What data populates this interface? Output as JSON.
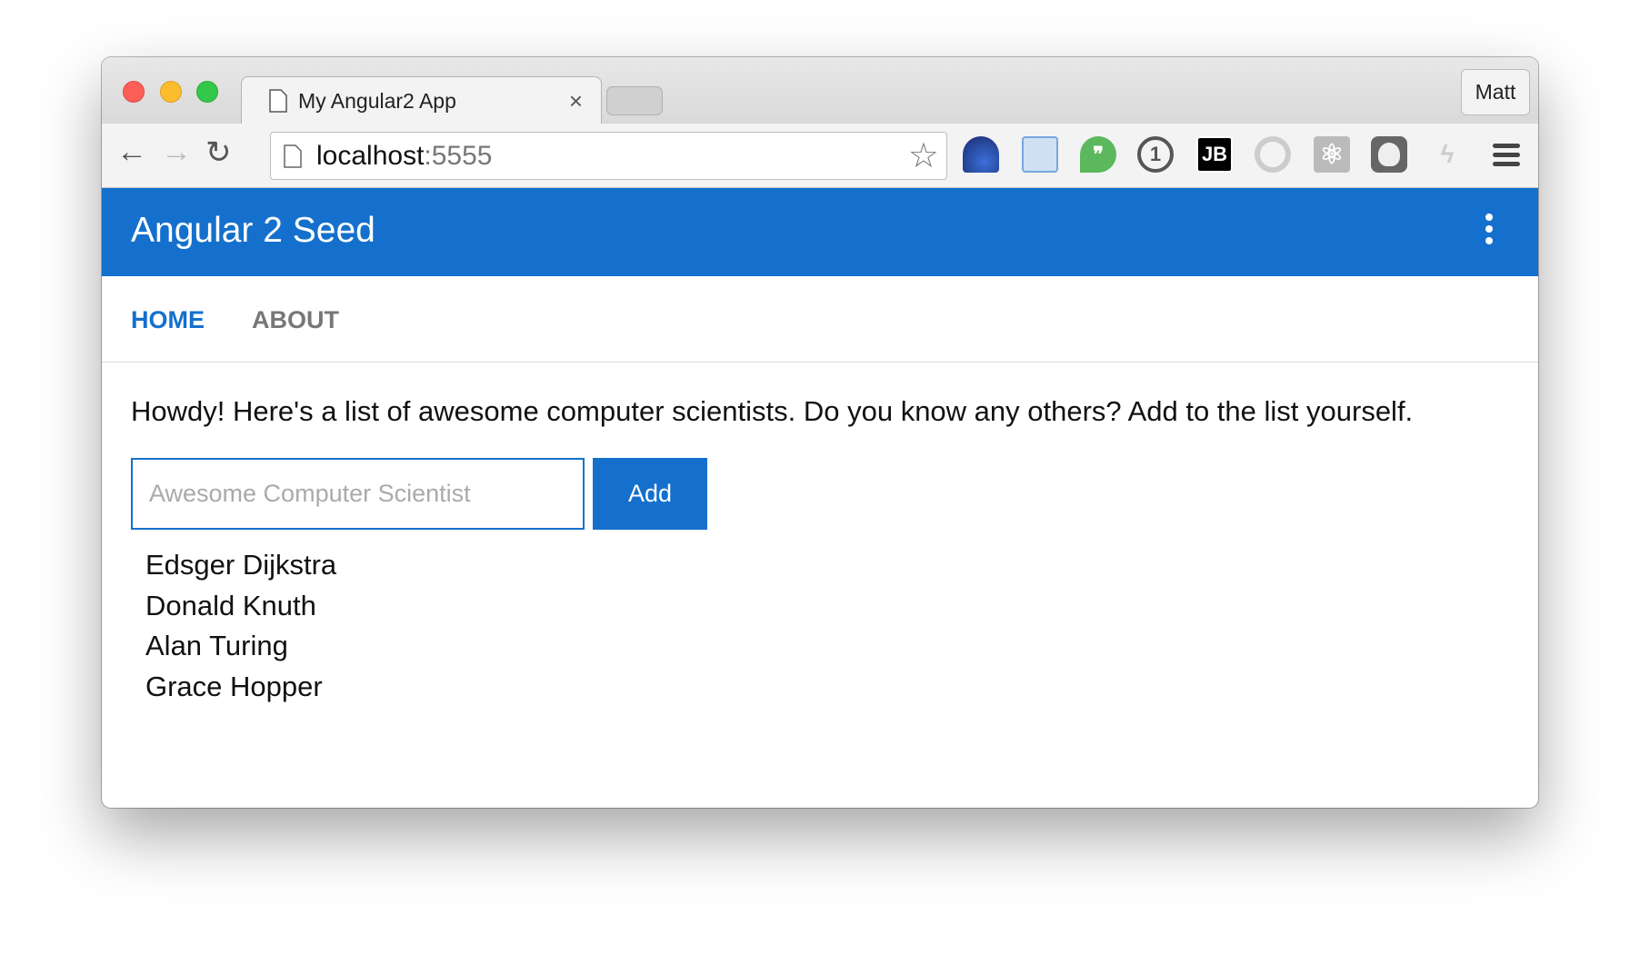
{
  "browser": {
    "tab_title": "My Angular2 App",
    "profile": "Matt",
    "url_host": "localhost",
    "url_port": ":5555",
    "extensions": [
      "speedometer-icon",
      "screen-share-icon",
      "hangouts-icon",
      "1password-icon",
      "jetbrains-icon",
      "json-viewer-icon",
      "react-devtools-icon",
      "ghostery-icon",
      "lightning-icon"
    ],
    "jb_label": "JB"
  },
  "app": {
    "title": "Angular 2 Seed",
    "accent": "#1470cc",
    "nav": [
      {
        "label": "HOME",
        "active": true
      },
      {
        "label": "ABOUT",
        "active": false
      }
    ],
    "intro": "Howdy! Here's a list of awesome computer scientists. Do you know any others? Add to the list yourself.",
    "input_placeholder": "Awesome Computer Scientist",
    "input_value": "",
    "add_label": "Add",
    "names": [
      "Edsger Dijkstra",
      "Donald Knuth",
      "Alan Turing",
      "Grace Hopper"
    ]
  }
}
